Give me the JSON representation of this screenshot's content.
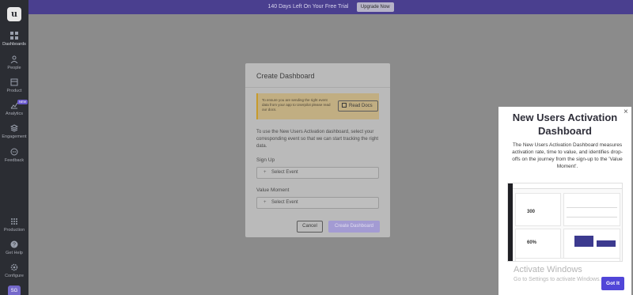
{
  "banner": {
    "text": "140 Days Left On Your Free Trial",
    "button": "Upgrade Now"
  },
  "sidebar": {
    "logo": "u",
    "items": [
      {
        "label": "Dashboards",
        "icon": "grid-icon"
      },
      {
        "label": "People",
        "icon": "people-icon"
      },
      {
        "label": "Product",
        "icon": "product-icon"
      },
      {
        "label": "Analytics",
        "icon": "chart-icon",
        "badge": "NEW"
      },
      {
        "label": "Engagement",
        "icon": "layers-icon"
      },
      {
        "label": "Feedback",
        "icon": "chat-icon"
      },
      {
        "label": "Production",
        "icon": "apps-icon"
      },
      {
        "label": "Get Help",
        "icon": "help-icon"
      },
      {
        "label": "Configure",
        "icon": "gear-icon"
      }
    ],
    "avatar": "SG"
  },
  "modal": {
    "title": "Create Dashboard",
    "notice_text": "To ensure you are sending the right event data from your app to Userpilot please read our docs.",
    "notice_button": "Read Docs",
    "description": "To use the New Users Activation dashboard, select your corresponding event so that we can start tracking the right data.",
    "field1_label": "Sign Up",
    "field1_value": "Select Event",
    "field2_label": "Value Moment",
    "field2_value": "Select Event",
    "cancel": "Cancel",
    "create": "Create Dashboard"
  },
  "promo": {
    "close": "×",
    "title": "New Users Activation Dashboard",
    "text": "The New Users Activation Dashboard measures activation rate, time to value, and identifies drop-offs on the journey from the sign-up to the 'Value Moment'.",
    "preview_value1": "300",
    "preview_value2": "60%",
    "watermark_title": "Activate Windows",
    "watermark_text": "Go to Settings to activate Windows.",
    "button": "Got It"
  },
  "colors": {
    "accent": "#5146d8",
    "banner": "#4a3f8f",
    "sidebar": "#2b2d33"
  }
}
